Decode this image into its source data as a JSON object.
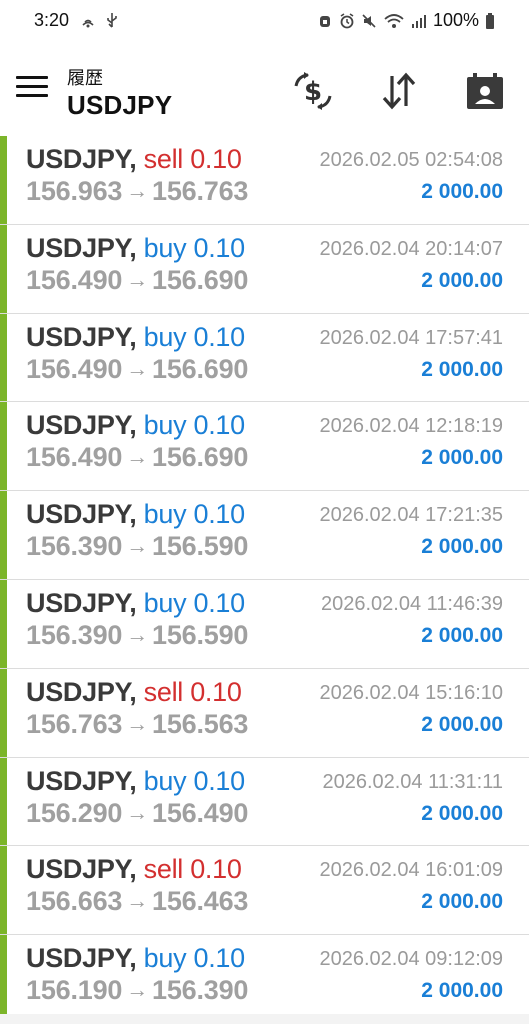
{
  "status_bar": {
    "time": "3:20",
    "battery": "100%",
    "left_icons": [
      "nfc-icon",
      "usb-icon"
    ],
    "right_icons": [
      "alarm-app-icon",
      "alarm-icon",
      "mute-icon",
      "wifi-icon",
      "signal-icon",
      "battery-icon"
    ]
  },
  "app_bar": {
    "subtitle": "履歴",
    "title": "USDJPY",
    "icons": [
      "menu-icon",
      "currency-exchange-icon",
      "sort-icon",
      "calendar-contact-icon"
    ]
  },
  "colors": {
    "accent": "#7cb52a",
    "buy": "#1a7fd6",
    "sell": "#d32f2f",
    "profit": "#1a7fd6"
  },
  "trades": [
    {
      "symbol": "USDJPY,",
      "side": "sell",
      "volume": "0.10",
      "open": "156.963",
      "close": "156.763",
      "time": "2026.02.05 02:54:08",
      "profit": "2 000.00"
    },
    {
      "symbol": "USDJPY,",
      "side": "buy",
      "volume": "0.10",
      "open": "156.490",
      "close": "156.690",
      "time": "2026.02.04 20:14:07",
      "profit": "2 000.00"
    },
    {
      "symbol": "USDJPY,",
      "side": "buy",
      "volume": "0.10",
      "open": "156.490",
      "close": "156.690",
      "time": "2026.02.04 17:57:41",
      "profit": "2 000.00"
    },
    {
      "symbol": "USDJPY,",
      "side": "buy",
      "volume": "0.10",
      "open": "156.490",
      "close": "156.690",
      "time": "2026.02.04 12:18:19",
      "profit": "2 000.00"
    },
    {
      "symbol": "USDJPY,",
      "side": "buy",
      "volume": "0.10",
      "open": "156.390",
      "close": "156.590",
      "time": "2026.02.04 17:21:35",
      "profit": "2 000.00"
    },
    {
      "symbol": "USDJPY,",
      "side": "buy",
      "volume": "0.10",
      "open": "156.390",
      "close": "156.590",
      "time": "2026.02.04 11:46:39",
      "profit": "2 000.00"
    },
    {
      "symbol": "USDJPY,",
      "side": "sell",
      "volume": "0.10",
      "open": "156.763",
      "close": "156.563",
      "time": "2026.02.04 15:16:10",
      "profit": "2 000.00"
    },
    {
      "symbol": "USDJPY,",
      "side": "buy",
      "volume": "0.10",
      "open": "156.290",
      "close": "156.490",
      "time": "2026.02.04 11:31:11",
      "profit": "2 000.00"
    },
    {
      "symbol": "USDJPY,",
      "side": "sell",
      "volume": "0.10",
      "open": "156.663",
      "close": "156.463",
      "time": "2026.02.04 16:01:09",
      "profit": "2 000.00"
    },
    {
      "symbol": "USDJPY,",
      "side": "buy",
      "volume": "0.10",
      "open": "156.190",
      "close": "156.390",
      "time": "2026.02.04 09:12:09",
      "profit": "2 000.00"
    }
  ],
  "arrow_glyph": "→"
}
